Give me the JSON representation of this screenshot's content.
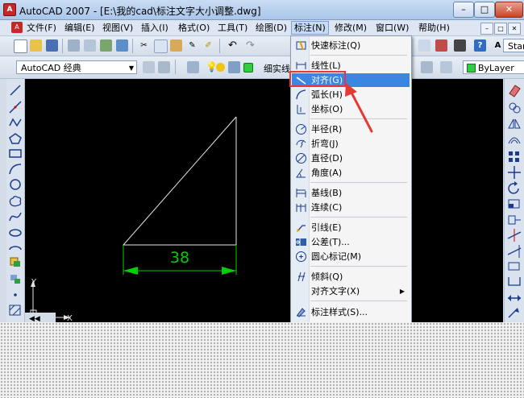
{
  "window": {
    "title": "AutoCAD 2007 - [E:\\我的cad\\标注文字大小调整.dwg]",
    "buttons": [
      "–",
      "□",
      "✕"
    ]
  },
  "menubar": {
    "items": [
      "文件(F)",
      "编辑(E)",
      "视图(V)",
      "插入(I)",
      "格式(O)",
      "工具(T)",
      "绘图(D)",
      "标注(N)",
      "修改(M)",
      "窗口(W)",
      "帮助(H)"
    ],
    "active_index": 7,
    "mdi_buttons": [
      "–",
      "□",
      "✕"
    ]
  },
  "toolbar": {
    "text_style_value": "Standa"
  },
  "layers_toolbar": {
    "workspace_value": "AutoCAD 经典",
    "layer_value": "细实线",
    "lineweight_value": "ByLayer"
  },
  "dimension_menu": {
    "items": [
      {
        "label": "快速标注(Q)",
        "icon": "quick-dimension-icon"
      },
      {
        "label": "线性(L)",
        "icon": "linear-dimension-icon"
      },
      {
        "label": "对齐(G)",
        "icon": "aligned-dimension-icon",
        "highlighted": true
      },
      {
        "label": "弧长(H)",
        "icon": "arc-length-icon"
      },
      {
        "label": "坐标(O)",
        "icon": "ordinate-icon"
      },
      {
        "label": "半径(R)",
        "icon": "radius-icon"
      },
      {
        "label": "折弯(J)",
        "icon": "jogged-icon"
      },
      {
        "label": "直径(D)",
        "icon": "diameter-icon"
      },
      {
        "label": "角度(A)",
        "icon": "angular-icon"
      },
      {
        "label": "基线(B)",
        "icon": "baseline-icon"
      },
      {
        "label": "连续(C)",
        "icon": "continue-icon"
      },
      {
        "label": "引线(E)",
        "icon": "leader-icon"
      },
      {
        "label": "公差(T)...",
        "icon": "tolerance-icon"
      },
      {
        "label": "圆心标记(M)",
        "icon": "center-mark-icon"
      },
      {
        "label": "倾斜(Q)",
        "icon": "oblique-icon"
      },
      {
        "label": "对齐文字(X)",
        "icon": "",
        "submenu": true
      },
      {
        "label": "标注样式(S)...",
        "icon": "dimension-style-icon"
      }
    ]
  },
  "drawing": {
    "dimension_text": "38",
    "ucs_y_label": "Y",
    "ucs_x_label": "X"
  },
  "colors": {
    "dimension": "#00d000",
    "annotation": "#e53935",
    "highlight": "#3b86e0",
    "canvas": "#000000"
  }
}
